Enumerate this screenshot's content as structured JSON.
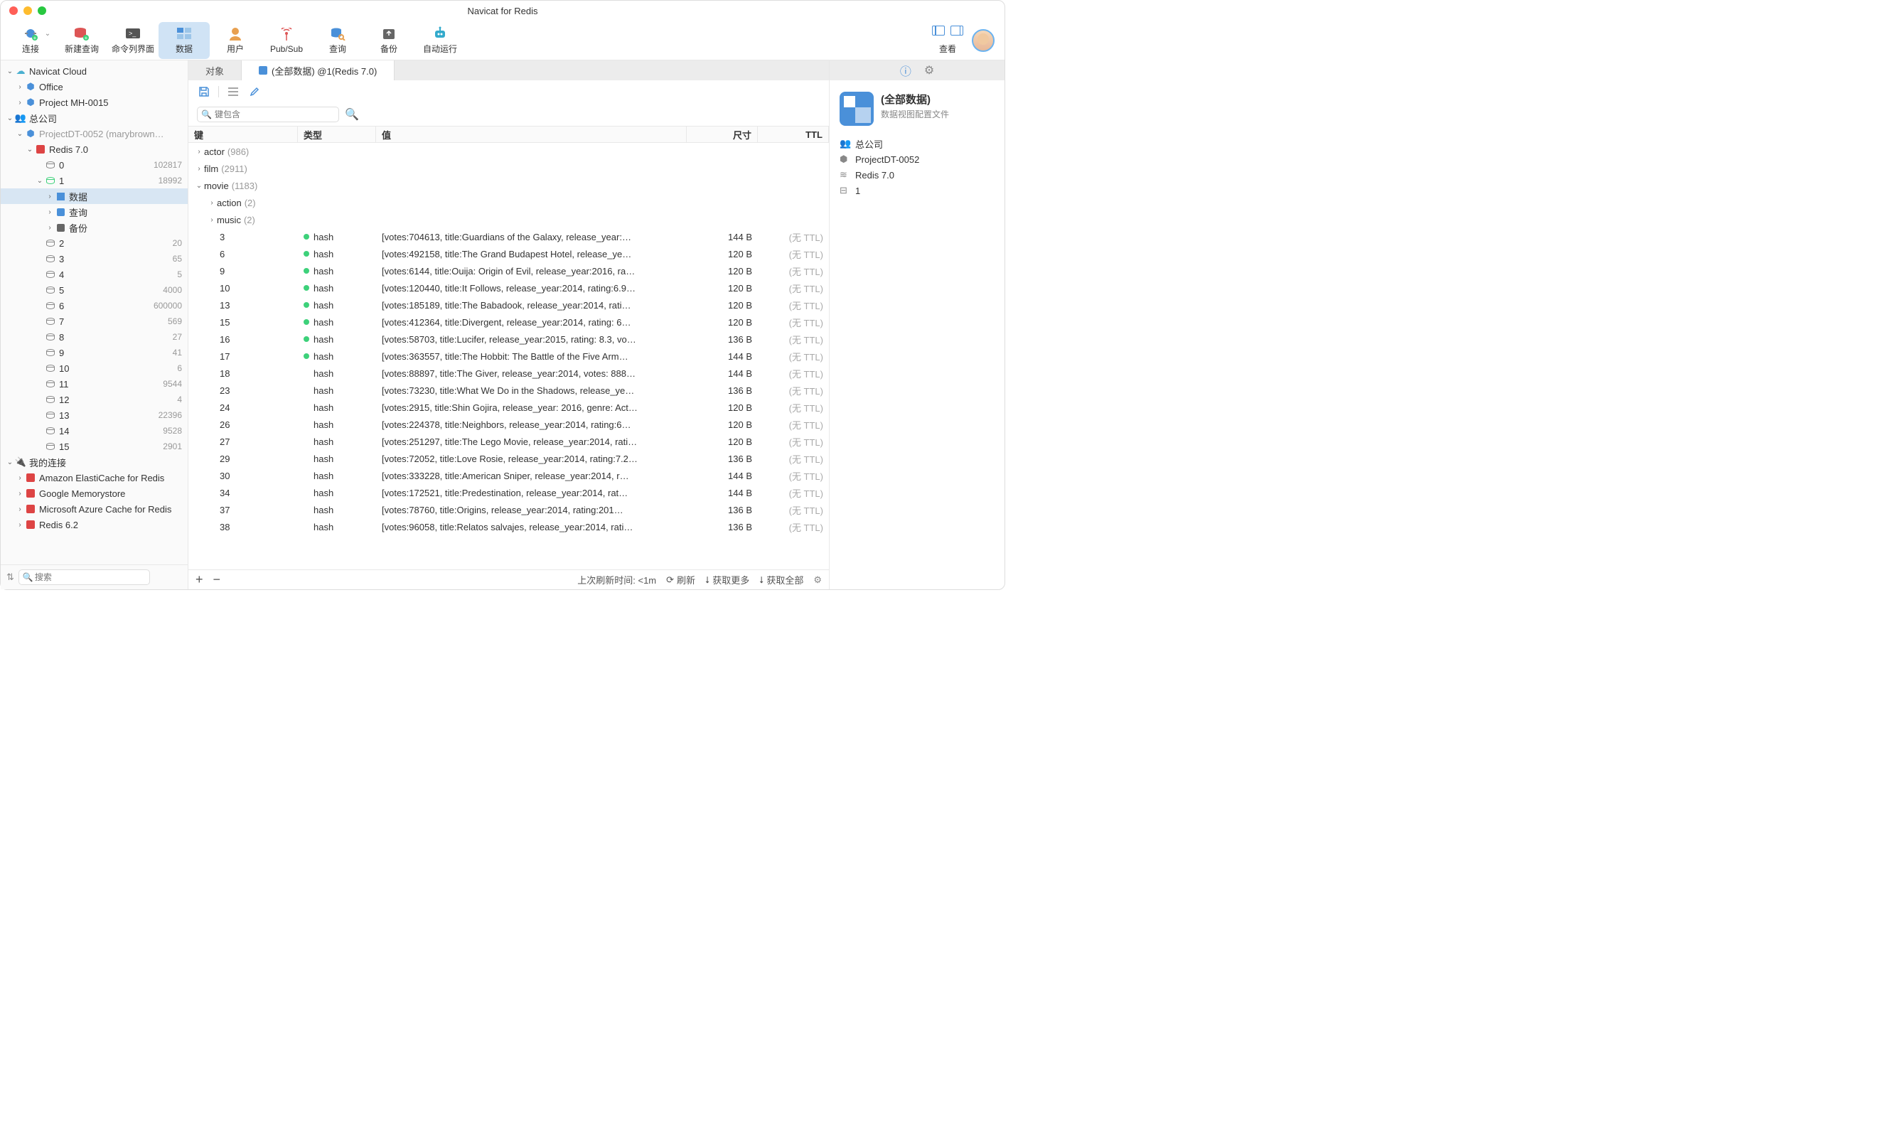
{
  "app_title": "Navicat for Redis",
  "toolbar": [
    {
      "label": "连接",
      "icon": "plug"
    },
    {
      "label": "新建查询",
      "icon": "db-new"
    },
    {
      "label": "命令列界面",
      "icon": "terminal"
    },
    {
      "label": "数据",
      "icon": "data",
      "active": true
    },
    {
      "label": "用户",
      "icon": "user"
    },
    {
      "label": "Pub/Sub",
      "icon": "antenna"
    },
    {
      "label": "查询",
      "icon": "search-db"
    },
    {
      "label": "备份",
      "icon": "backup"
    },
    {
      "label": "自动运行",
      "icon": "robot"
    }
  ],
  "view_label": "查看",
  "sidebar": {
    "search_placeholder": "搜索",
    "nodes": [
      {
        "indent": 0,
        "chev": "down",
        "icon": "cloud",
        "label": "Navicat Cloud"
      },
      {
        "indent": 1,
        "chev": "right",
        "icon": "cube",
        "label": "Office"
      },
      {
        "indent": 1,
        "chev": "right",
        "icon": "cube",
        "label": "Project MH-0015"
      },
      {
        "indent": 0,
        "chev": "down",
        "icon": "group",
        "label": "总公司"
      },
      {
        "indent": 1,
        "chev": "down",
        "icon": "cube",
        "label": "ProjectDT-0052 (marybrown…",
        "grey": true
      },
      {
        "indent": 2,
        "chev": "down",
        "icon": "redis",
        "label": "Redis 7.0"
      },
      {
        "indent": 3,
        "chev": "",
        "icon": "db",
        "label": "0",
        "count": "102817"
      },
      {
        "indent": 3,
        "chev": "down",
        "icon": "db-green",
        "label": "1",
        "count": "18992"
      },
      {
        "indent": 4,
        "chev": "right",
        "icon": "tile",
        "label": "数据",
        "selected": true
      },
      {
        "indent": 4,
        "chev": "right",
        "icon": "query",
        "label": "查询"
      },
      {
        "indent": 4,
        "chev": "right",
        "icon": "backup",
        "label": "备份"
      },
      {
        "indent": 3,
        "chev": "",
        "icon": "db",
        "label": "2",
        "count": "20"
      },
      {
        "indent": 3,
        "chev": "",
        "icon": "db",
        "label": "3",
        "count": "65"
      },
      {
        "indent": 3,
        "chev": "",
        "icon": "db",
        "label": "4",
        "count": "5"
      },
      {
        "indent": 3,
        "chev": "",
        "icon": "db",
        "label": "5",
        "count": "4000"
      },
      {
        "indent": 3,
        "chev": "",
        "icon": "db",
        "label": "6",
        "count": "600000"
      },
      {
        "indent": 3,
        "chev": "",
        "icon": "db",
        "label": "7",
        "count": "569"
      },
      {
        "indent": 3,
        "chev": "",
        "icon": "db",
        "label": "8",
        "count": "27"
      },
      {
        "indent": 3,
        "chev": "",
        "icon": "db",
        "label": "9",
        "count": "41"
      },
      {
        "indent": 3,
        "chev": "",
        "icon": "db",
        "label": "10",
        "count": "6"
      },
      {
        "indent": 3,
        "chev": "",
        "icon": "db",
        "label": "11",
        "count": "9544"
      },
      {
        "indent": 3,
        "chev": "",
        "icon": "db",
        "label": "12",
        "count": "4"
      },
      {
        "indent": 3,
        "chev": "",
        "icon": "db",
        "label": "13",
        "count": "22396"
      },
      {
        "indent": 3,
        "chev": "",
        "icon": "db",
        "label": "14",
        "count": "9528"
      },
      {
        "indent": 3,
        "chev": "",
        "icon": "db",
        "label": "15",
        "count": "2901"
      },
      {
        "indent": 0,
        "chev": "down",
        "icon": "plug-grey",
        "label": "我的连接"
      },
      {
        "indent": 1,
        "chev": "right",
        "icon": "redis-cloud",
        "label": "Amazon ElastiCache for Redis"
      },
      {
        "indent": 1,
        "chev": "right",
        "icon": "redis-cloud",
        "label": "Google Memorystore"
      },
      {
        "indent": 1,
        "chev": "right",
        "icon": "redis-cloud",
        "label": "Microsoft Azure Cache for Redis"
      },
      {
        "indent": 1,
        "chev": "right",
        "icon": "redis",
        "label": "Redis 6.2"
      }
    ]
  },
  "tabs": [
    {
      "label": "对象"
    },
    {
      "label": "(全部数据) @1(Redis 7.0)",
      "active": true,
      "icon": true
    }
  ],
  "filter_placeholder": "键包含",
  "columns": {
    "key": "键",
    "type": "类型",
    "value": "值",
    "size": "尺寸",
    "ttl": "TTL"
  },
  "groups": [
    {
      "indent": 0,
      "chev": "right",
      "name": "actor",
      "count": "(986)"
    },
    {
      "indent": 0,
      "chev": "right",
      "name": "film",
      "count": "(2911)"
    },
    {
      "indent": 0,
      "chev": "down",
      "name": "movie",
      "count": "(1183)"
    },
    {
      "indent": 1,
      "chev": "right",
      "name": "action",
      "count": "(2)"
    },
    {
      "indent": 1,
      "chev": "right",
      "name": "music",
      "count": "(2)"
    }
  ],
  "rows": [
    {
      "key": "3",
      "dot": true,
      "type": "hash",
      "value": "[votes:704613, title:Guardians of the Galaxy, release_year:…",
      "size": "144 B",
      "ttl": "(无 TTL)"
    },
    {
      "key": "6",
      "dot": true,
      "type": "hash",
      "value": "[votes:492158, title:The Grand Budapest Hotel, release_ye…",
      "size": "120 B",
      "ttl": "(无 TTL)"
    },
    {
      "key": "9",
      "dot": true,
      "type": "hash",
      "value": "[votes:6144, title:Ouija: Origin of Evil, release_year:2016, ra…",
      "size": "120 B",
      "ttl": "(无 TTL)"
    },
    {
      "key": "10",
      "dot": true,
      "type": "hash",
      "value": "[votes:120440, title:It Follows, release_year:2014, rating:6.9…",
      "size": "120 B",
      "ttl": "(无 TTL)"
    },
    {
      "key": "13",
      "dot": true,
      "type": "hash",
      "value": "[votes:185189, title:The Babadook, release_year:2014, rati…",
      "size": "120 B",
      "ttl": "(无 TTL)"
    },
    {
      "key": "15",
      "dot": true,
      "type": "hash",
      "value": "[votes:412364, title:Divergent, release_year:2014, rating: 6…",
      "size": "120 B",
      "ttl": "(无 TTL)"
    },
    {
      "key": "16",
      "dot": true,
      "type": "hash",
      "value": "[votes:58703, title:Lucifer, release_year:2015, rating: 8.3, vo…",
      "size": "136 B",
      "ttl": "(无 TTL)"
    },
    {
      "key": "17",
      "dot": true,
      "type": "hash",
      "value": "[votes:363557, title:The Hobbit: The Battle of the Five Arm…",
      "size": "144 B",
      "ttl": "(无 TTL)"
    },
    {
      "key": "18",
      "dot": false,
      "type": "hash",
      "value": "[votes:88897, title:The Giver, release_year:2014, votes: 888…",
      "size": "144 B",
      "ttl": "(无 TTL)"
    },
    {
      "key": "23",
      "dot": false,
      "type": "hash",
      "value": "[votes:73230, title:What We Do in the Shadows, release_ye…",
      "size": "136 B",
      "ttl": "(无 TTL)"
    },
    {
      "key": "24",
      "dot": false,
      "type": "hash",
      "value": "[votes:2915, title:Shin Gojira, release_year: 2016, genre: Act…",
      "size": "120 B",
      "ttl": "(无 TTL)"
    },
    {
      "key": "26",
      "dot": false,
      "type": "hash",
      "value": "[votes:224378, title:Neighbors, release_year:2014, rating:6…",
      "size": "120 B",
      "ttl": "(无 TTL)"
    },
    {
      "key": "27",
      "dot": false,
      "type": "hash",
      "value": "[votes:251297, title:The Lego Movie, release_year:2014, rati…",
      "size": "120 B",
      "ttl": "(无 TTL)"
    },
    {
      "key": "29",
      "dot": false,
      "type": "hash",
      "value": "[votes:72052, title:Love Rosie, release_year:2014, rating:7.2…",
      "size": "136 B",
      "ttl": "(无 TTL)"
    },
    {
      "key": "30",
      "dot": false,
      "type": "hash",
      "value": "[votes:333228, title:American Sniper, release_year:2014, r…",
      "size": "144 B",
      "ttl": "(无 TTL)"
    },
    {
      "key": "34",
      "dot": false,
      "type": "hash",
      "value": "[votes:172521, title:Predestination, release_year:2014, rat…",
      "size": "144 B",
      "ttl": "(无 TTL)"
    },
    {
      "key": "37",
      "dot": false,
      "type": "hash",
      "value": "[votes:78760, title:Origins, release_year:2014, rating:201…",
      "size": "136 B",
      "ttl": "(无 TTL)"
    },
    {
      "key": "38",
      "dot": false,
      "type": "hash",
      "value": "[votes:96058, title:Relatos salvajes, release_year:2014, rati…",
      "size": "136 B",
      "ttl": "(无 TTL)"
    }
  ],
  "statusbar": {
    "last_refresh": "上次刷新时间: <1m",
    "refresh": "刷新",
    "fetch_more": "获取更多",
    "fetch_all": "获取全部"
  },
  "rightpane": {
    "title": "(全部数据)",
    "subtitle": "数据视图配置文件",
    "lines": [
      {
        "icon": "group",
        "label": "总公司"
      },
      {
        "icon": "cube",
        "label": "ProjectDT-0052"
      },
      {
        "icon": "stack",
        "label": "Redis 7.0"
      },
      {
        "icon": "db",
        "label": "1"
      }
    ]
  }
}
